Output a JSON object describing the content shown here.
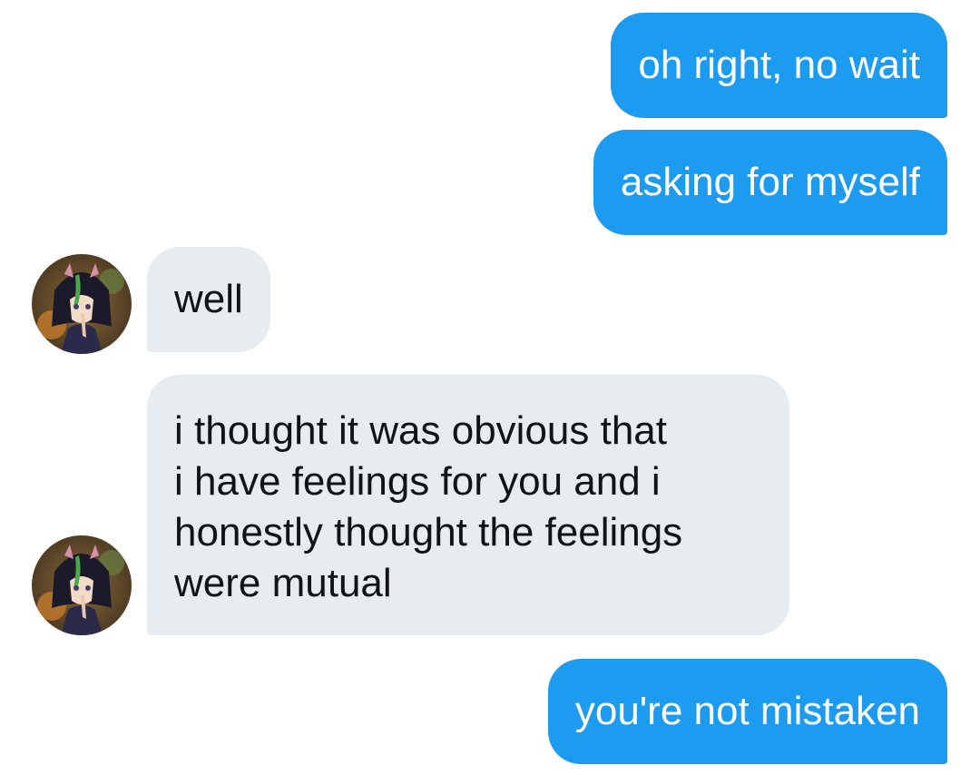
{
  "conversation": {
    "messages": [
      {
        "sender": "me",
        "text": "oh right, no wait"
      },
      {
        "sender": "me",
        "text": "asking for myself"
      },
      {
        "sender": "them",
        "text": "well"
      },
      {
        "sender": "them",
        "lines": [
          "i thought it was obvious that",
          "i have feelings for you and i",
          "honestly thought the feelings",
          "were mutual"
        ]
      },
      {
        "sender": "me",
        "text": "you're not mistaken"
      }
    ]
  },
  "colors": {
    "sent_bubble": "#1d9bf0",
    "received_bubble": "#e7ecf0",
    "received_text": "#0f1419",
    "background": "#ffffff"
  },
  "icons": {
    "contact_avatar": "anime-character-avatar"
  }
}
